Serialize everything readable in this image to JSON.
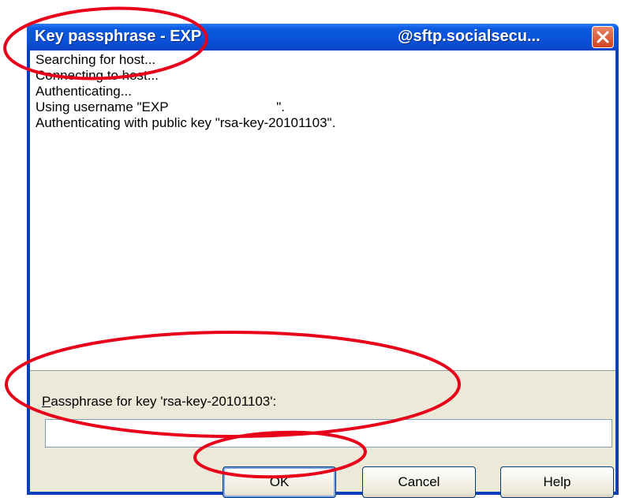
{
  "window": {
    "title_left": "Key passphrase - EXP",
    "title_right": "@sftp.socialsecu...",
    "close_icon": "close-icon"
  },
  "log": {
    "lines": [
      "Searching for host...",
      "Connecting to host...",
      "Authenticating...",
      "Using username \"EXP                             \".",
      "Authenticating with public key \"rsa-key-20101103\"."
    ]
  },
  "passphrase": {
    "label_accel": "P",
    "label_rest": "assphrase for key 'rsa-key-20101103':",
    "value": ""
  },
  "buttons": {
    "ok": "OK",
    "cancel": "Cancel",
    "help": "Help"
  },
  "colors": {
    "titlebar": "#0a52d9",
    "client_bg": "#ece9d8",
    "annotation": "#e8001a"
  }
}
